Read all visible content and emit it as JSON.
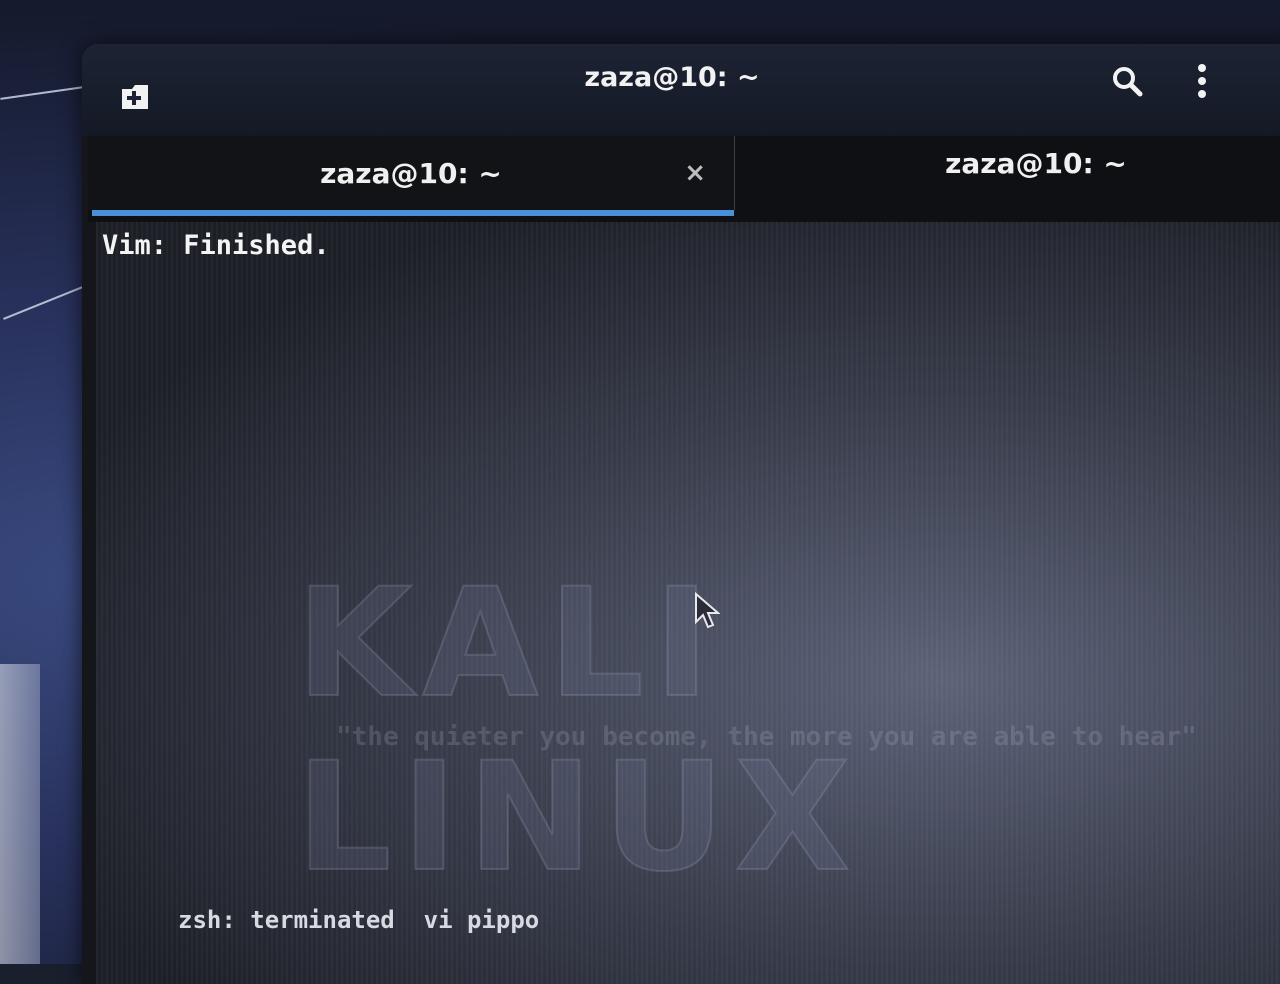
{
  "window": {
    "title": "zaza@10: ~"
  },
  "header": {
    "new_tab_icon": "new-tab-icon",
    "search_icon": "search-icon",
    "menu_icon": "kebab-menu-icon"
  },
  "tabs": [
    {
      "label": "zaza@10: ~",
      "active": true,
      "close_glyph": "×"
    },
    {
      "label": "zaza@10: ~",
      "active": false
    }
  ],
  "terminal": {
    "lines": {
      "vim_message": "Vim: Finished.",
      "zsh_message": "zsh: terminated  vi pippo"
    }
  },
  "wallpaper": {
    "logo_text": "KALI LINUX",
    "tagline": "\"the quieter you become, the more you are able to hear\""
  },
  "colors": {
    "accent": "#4a90d9",
    "header_bg": "#1c2333",
    "tab_bg": "#121317"
  }
}
